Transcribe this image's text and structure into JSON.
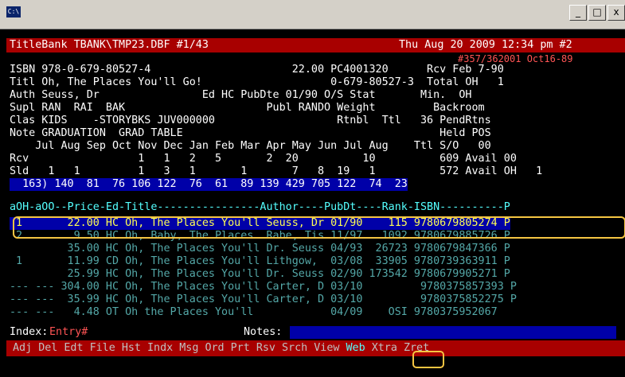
{
  "window": {
    "sys_icon": "C:\\",
    "btn_min": "_",
    "btn_max": "□",
    "btn_close": "x"
  },
  "header": {
    "left": "TitleBank TBANK\\TMP23.DBF #1/43",
    "right": "Thu Aug 20 2009 12:34 pm #2",
    "sub": "#357/362001 Oct16-89"
  },
  "record": {
    "l1": "ISBN 978-0-679-80527-4                      22.00 PC4001320      Rcv Feb 7-90",
    "l2": "Titl Oh, The Places You'll Go!                    0-679-80527-3  Total OH   1",
    "l3": "Auth Seuss, Dr                Ed HC PubDte 01/90 O/S Stat       Min.  OH",
    "l4": "Supl RAN  RAI  BAK                      Publ RANDO Weight         Backroom",
    "l5": "Clas KIDS    -STORYBKS JUV000000                   Rtnbl  Ttl   36 PendRtns",
    "l6": "Note GRADUATION  GRAD TABLE                                        Held POS",
    "l7": "    Jul Aug Sep Oct Nov Dec Jan Feb Mar Apr May Jun Jul Aug    Ttl S/O   00",
    "l8": "Rcv                 1   1   2   5       2  20          10          609 Avail 00",
    "l9": "Sld   1   1         1   3   1       1       7   8  19   1          572 Avail OH   1",
    "l10": "  163) 140  81  76 106 122  76  61  89 139 429 705 122  74  23"
  },
  "table": {
    "header": "aOH-aOO--Price-Ed-Title----------------Author----PubDt----Rank-ISBN----------P",
    "rows": [
      " 1       22.00 HC Oh, The Places You'll Seuss, Dr 01/90    115 9780679805274 P",
      " 2        9.50 HC Oh, Baby, The Places  Rabe, Tis 11/97   1092 9780679885726 P",
      "         35.00 HC Oh, The Places You'll Dr. Seuss 04/93  26723 9780679847366 P",
      " 1       11.99 CD Oh, The Places You'll Lithgow,  03/08  33905 9780739363911 P",
      "         25.99 HC Oh, The Places You'll Dr. Seuss 02/90 173542 9780679905271 P",
      "--- --- 304.00 HC Oh, The Places You'll Carter, D 03/10         9780375857393 P",
      "--- ---  35.99 HC Oh, The Places You'll Carter, D 03/10         9780375852275 P",
      "--- ---   4.48 OT Oh the Places You'll            04/09    OSI 9780375952067"
    ]
  },
  "index_line": {
    "label": "Index:",
    "value": "Entry#",
    "notes": "Notes:"
  },
  "menu": [
    "Adj",
    "Del",
    "Edt",
    "File",
    "Hst",
    "Indx",
    "Msg",
    "Ord",
    "Prt",
    "Rsv",
    "Srch",
    "View",
    "Web",
    "Xtra",
    "Zret"
  ]
}
